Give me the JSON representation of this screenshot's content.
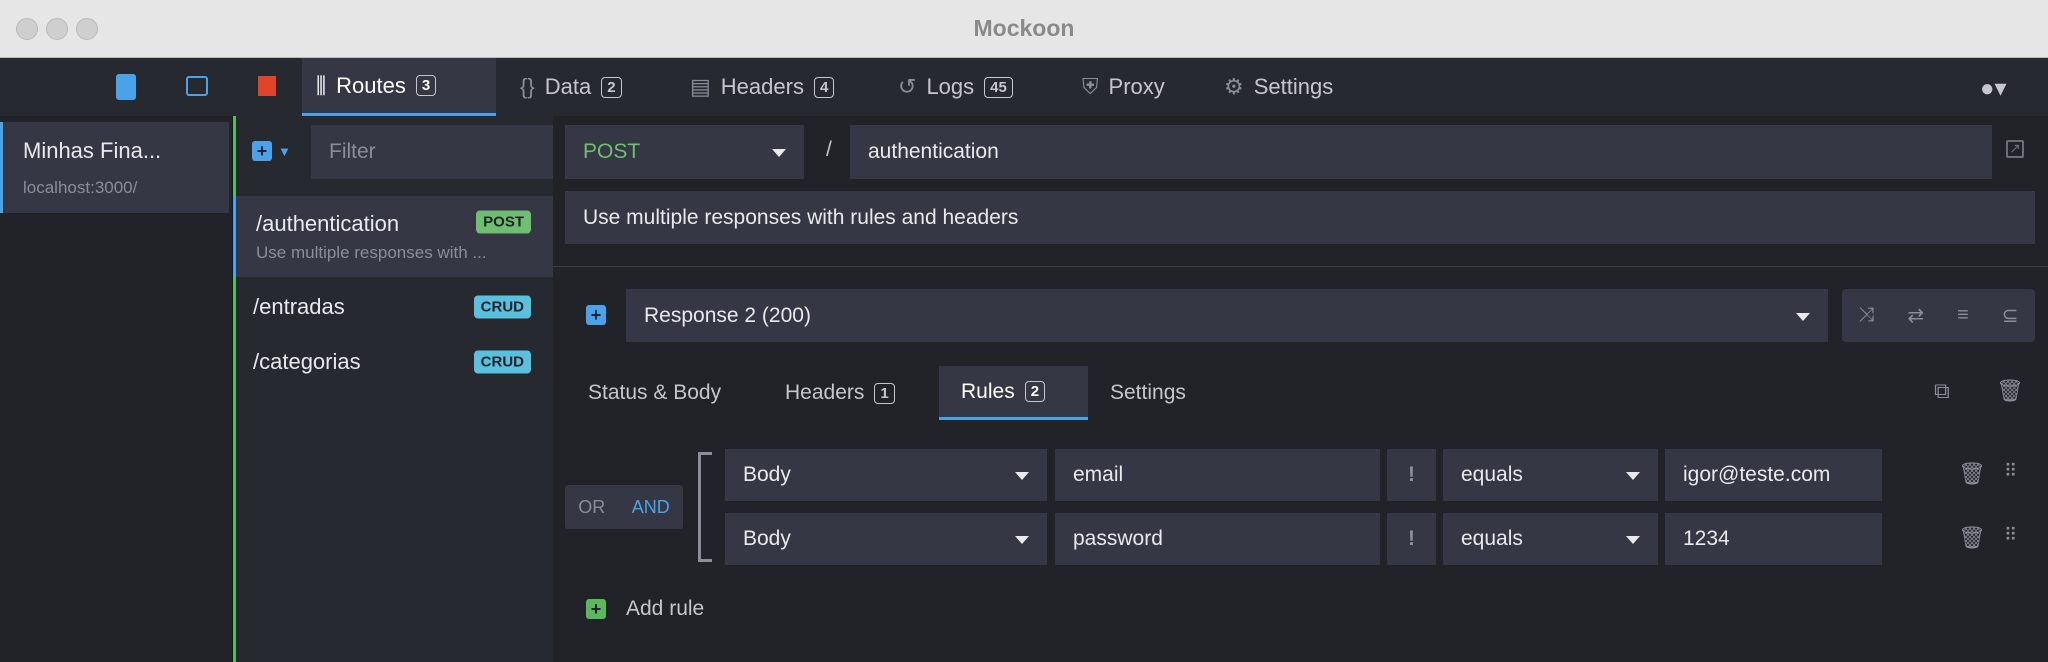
{
  "window": {
    "title": "Mockoon"
  },
  "nav": {
    "tabs": [
      {
        "label": "Routes",
        "count": "3"
      },
      {
        "label": "Data",
        "count": "2"
      },
      {
        "label": "Headers",
        "count": "4"
      },
      {
        "label": "Logs",
        "count": "45"
      },
      {
        "label": "Proxy"
      },
      {
        "label": "Settings"
      }
    ]
  },
  "environment": {
    "name": "Minhas Fina...",
    "url": "localhost:3000/"
  },
  "routes": {
    "filter_placeholder": "Filter",
    "items": [
      {
        "path": "/authentication",
        "method": "POST",
        "description": "Use multiple responses with ...",
        "color": "#6fbf73"
      },
      {
        "path": "/entradas",
        "method": "CRUD",
        "color": "#5bc0de"
      },
      {
        "path": "/categorias",
        "method": "CRUD",
        "color": "#5bc0de"
      }
    ]
  },
  "route": {
    "method": "POST",
    "separator": "/",
    "path": "authentication",
    "description": "Use multiple responses with rules and headers"
  },
  "response": {
    "selected": "Response 2 (200)",
    "tabs": [
      {
        "label": "Status & Body"
      },
      {
        "label": "Headers",
        "count": "1"
      },
      {
        "label": "Rules",
        "count": "2"
      },
      {
        "label": "Settings"
      }
    ]
  },
  "rules": {
    "or_label": "OR",
    "and_label": "AND",
    "items": [
      {
        "target": "Body",
        "property": "email",
        "negate": "!",
        "operator": "equals",
        "value": "igor@teste.com"
      },
      {
        "target": "Body",
        "property": "password",
        "negate": "!",
        "operator": "equals",
        "value": "1234"
      }
    ],
    "add_label": "Add rule"
  }
}
